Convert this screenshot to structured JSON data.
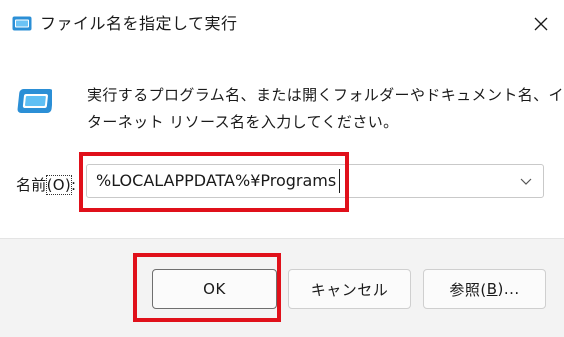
{
  "window": {
    "title": "ファイル名を指定して実行",
    "close_icon": "close-icon",
    "title_icon": "run-dialog-icon"
  },
  "dialog": {
    "icon": "run-dialog-icon",
    "description_line1": "実行するプログラム名、または開くフォルダーやドキュメント名、イン",
    "description_line2": "ターネット リソース名を入力してください。",
    "name_label_prefix": "名前",
    "name_label_paren": "(O)",
    "name_label_suffix": ":",
    "input_value": "%LOCALAPPDATA%¥Programs",
    "dropdown_icon": "chevron-down-icon"
  },
  "buttons": {
    "ok_label": "OK",
    "cancel_label": "キャンセル",
    "browse_prefix": "参照(",
    "browse_mnemonic": "B",
    "browse_suffix": ")..."
  },
  "colors": {
    "highlight": "#e0101a",
    "footer_bg": "#f3f3f3",
    "icon_blue": "#2b8fd6"
  }
}
